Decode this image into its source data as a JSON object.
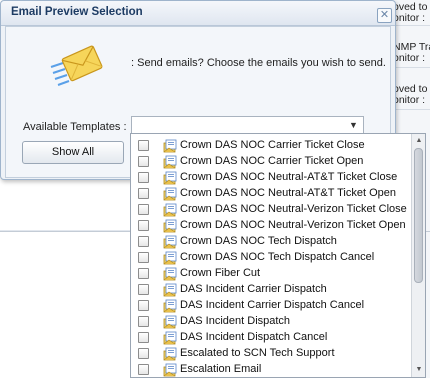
{
  "dialog": {
    "title": "Email Preview Selection",
    "close_glyph": "✕",
    "message": ": Send emails? Choose the emails you wish to send.",
    "templates_label": "Available Templates :",
    "select_value": "",
    "show_all_label": "Show All"
  },
  "background": {
    "cells": [
      "oved to",
      "onitor :",
      "NMP Tra",
      "onitor :",
      "oved to",
      "onitor :"
    ]
  },
  "dropdown": {
    "items": [
      {
        "label": "Crown DAS NOC Carrier Ticket Close",
        "checked": false
      },
      {
        "label": "Crown DAS NOC Carrier Ticket Open",
        "checked": false
      },
      {
        "label": "Crown DAS NOC Neutral-AT&T Ticket Close",
        "checked": false
      },
      {
        "label": "Crown DAS NOC Neutral-AT&T Ticket Open",
        "checked": false
      },
      {
        "label": "Crown DAS NOC Neutral-Verizon Ticket Close",
        "checked": false
      },
      {
        "label": "Crown DAS NOC Neutral-Verizon Ticket Open",
        "checked": false
      },
      {
        "label": "Crown DAS NOC Tech Dispatch",
        "checked": false
      },
      {
        "label": "Crown DAS NOC Tech Dispatch Cancel",
        "checked": false
      },
      {
        "label": "Crown Fiber Cut",
        "checked": false
      },
      {
        "label": "DAS Incident Carrier Dispatch",
        "checked": false
      },
      {
        "label": "DAS Incident Carrier Dispatch Cancel",
        "checked": false
      },
      {
        "label": "DAS Incident Dispatch",
        "checked": false
      },
      {
        "label": "DAS Incident Dispatch Cancel",
        "checked": false
      },
      {
        "label": "Escalated to SCN Tech Support",
        "checked": false
      },
      {
        "label": "Escalation Email",
        "checked": false
      }
    ],
    "item_icon": "email-template-icon"
  },
  "colors": {
    "title_text": "#1d3b63",
    "dialog_bg": "#eef2f7",
    "border": "#9fb4cc"
  }
}
